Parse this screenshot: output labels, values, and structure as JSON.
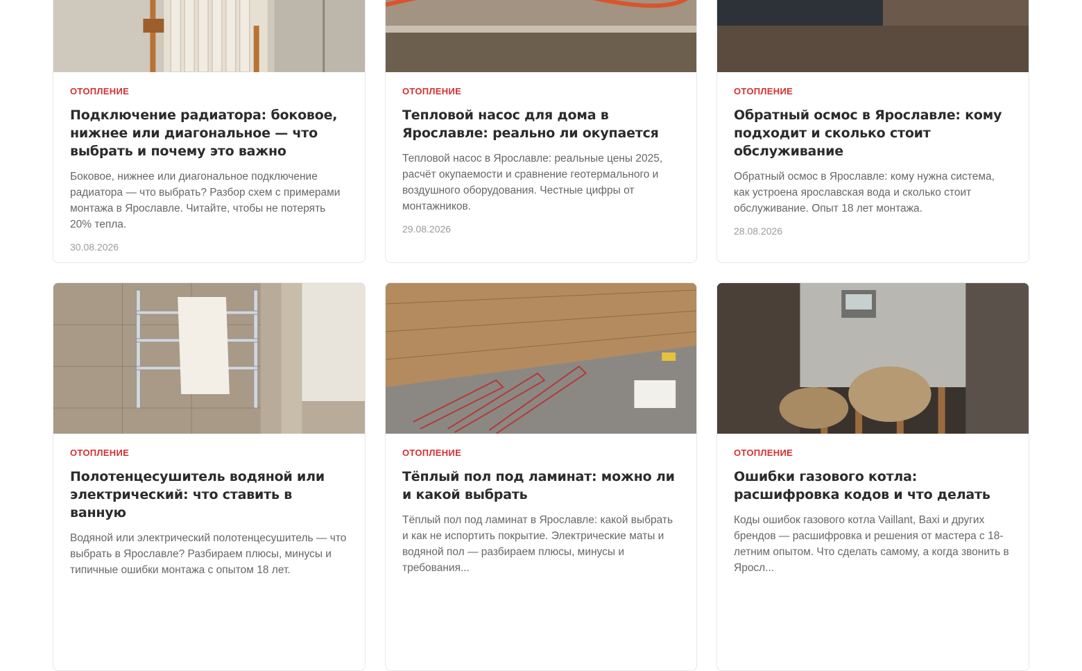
{
  "articles": [
    {
      "category": "ОТОПЛЕНИЕ",
      "title": "Подключение радиатора: боковое, нижнее или диагональное — что выбрать и почему это важно",
      "excerpt": "Боковое, нижнее или диагональное подключение радиатора — что выбрать? Разбор схем с примерами монтажа в Ярославле. Читайте, чтобы не потерять 20% тепла.",
      "date": "30.08.2026"
    },
    {
      "category": "ОТОПЛЕНИЕ",
      "title": "Тепловой насос для дома в Ярославле: реально ли окупается",
      "excerpt": "Тепловой насос в Ярославле: реальные цены 2025, расчёт окупаемости и сравнение геотермального и воздушного оборудования. Честные цифры от монтажников.",
      "date": "29.08.2026"
    },
    {
      "category": "ОТОПЛЕНИЕ",
      "title": "Обратный осмос в Ярославле: кому подходит и сколько стоит обслуживание",
      "excerpt": "Обратный осмос в Ярославле: кому нужна система, как устроена ярославская вода и сколько стоит обслуживание. Опыт 18 лет монтажа.",
      "date": "28.08.2026"
    },
    {
      "category": "ОТОПЛЕНИЕ",
      "title": "Полотенцесушитель водяной или электрический: что ставить в ванную",
      "excerpt": "Водяной или электрический полотенцесушитель — что выбрать в Ярославле? Разбираем плюсы, минусы и типичные ошибки монтажа с опытом 18 лет.",
      "date": ""
    },
    {
      "category": "ОТОПЛЕНИЕ",
      "title": "Тёплый пол под ламинат: можно ли и какой выбрать",
      "excerpt": "Тёплый пол под ламинат в Ярославле: какой выбрать и как не испортить покрытие. Электрические маты и водяной пол — разбираем плюсы, минусы и требования...",
      "date": ""
    },
    {
      "category": "ОТОПЛЕНИЕ",
      "title": "Ошибки газового котла: расшифровка кодов и что делать",
      "excerpt": "Коды ошибок газового котла Vaillant, Baxi и других брендов — расшифровка и решения от мастера с 18-летним опытом. Что сделать самому, а когда звонить в Яросл...",
      "date": ""
    }
  ]
}
